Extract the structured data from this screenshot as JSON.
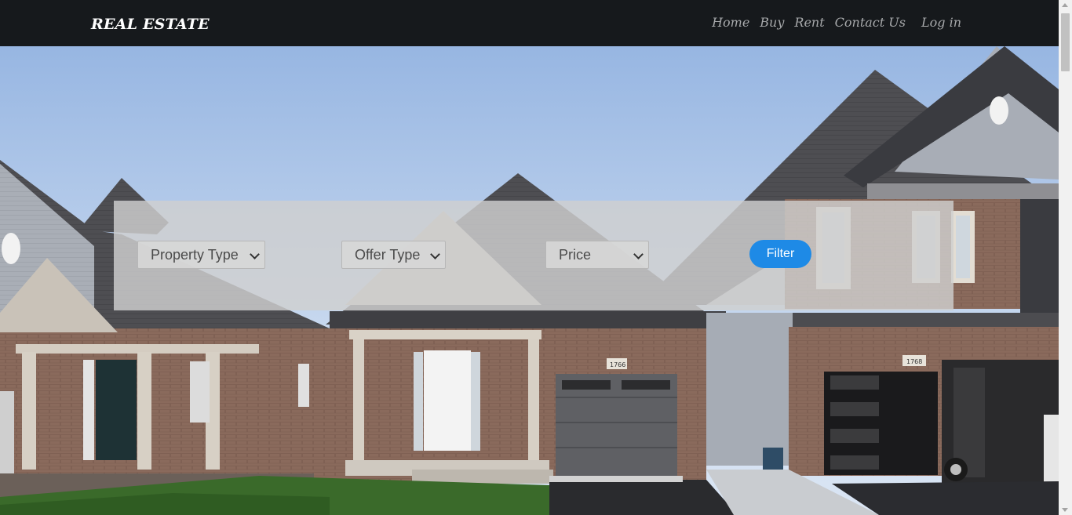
{
  "header": {
    "brand": "REAL ESTATE",
    "nav": [
      "Home",
      "Buy",
      "Rent",
      "Contact Us",
      "Log in"
    ]
  },
  "filters": {
    "property_type": "Property Type",
    "offer_type": "Offer Type",
    "price": "Price",
    "filter_button": "Filter"
  },
  "hero": {
    "house_numbers": [
      "1766",
      "1768"
    ]
  },
  "colors": {
    "navbar": "#16191c",
    "accent": "#1e8ae6"
  }
}
